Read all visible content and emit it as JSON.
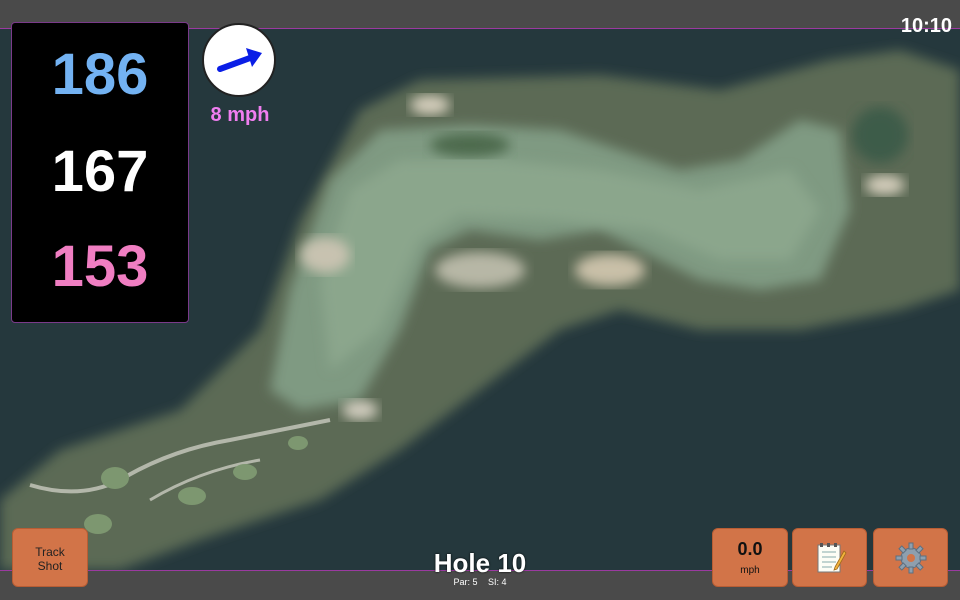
{
  "clock": "10:10",
  "distances": {
    "front": "186",
    "middle": "167",
    "back": "153",
    "colors": {
      "front": "#73b2f2",
      "middle": "#ffffff",
      "back": "#f07ec2"
    }
  },
  "wind": {
    "speed": "8 mph",
    "arrow_icon": "wind-direction-arrow",
    "arrow_color": "#0a1ee6"
  },
  "hole": {
    "title": "Hole 10",
    "par": "Par: 5",
    "si": "SI: 4"
  },
  "buttons": {
    "track_shot_line1": "Track",
    "track_shot_line2": "Shot",
    "speed_value": "0.0",
    "speed_unit": "mph",
    "notes_icon": "notepad-icon",
    "settings_icon": "gear-icon",
    "color": "#d27448"
  },
  "theme": {
    "bar_color": "#4a4a4a",
    "accent_border": "#9b3aa0",
    "map_background": "#25383d"
  }
}
